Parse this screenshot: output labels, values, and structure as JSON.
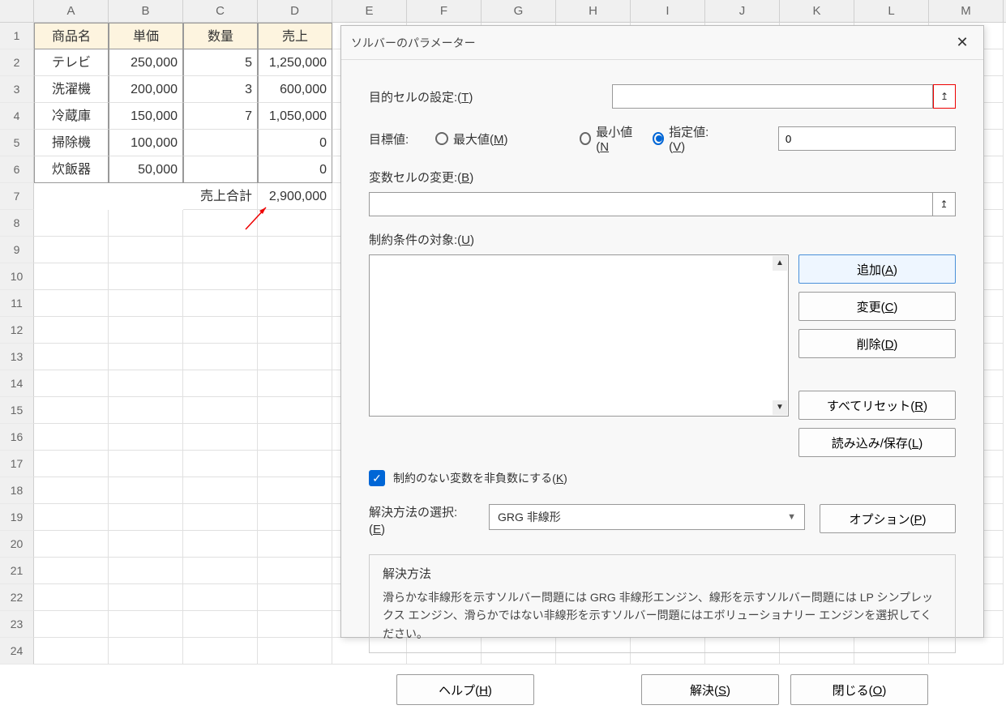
{
  "columns": [
    "A",
    "B",
    "C",
    "D",
    "E",
    "F",
    "G",
    "H",
    "I",
    "J",
    "K",
    "L",
    "M"
  ],
  "rowCount": 24,
  "headers": {
    "a": "商品名",
    "b": "単価",
    "c": "数量",
    "d": "売上"
  },
  "data": [
    {
      "name": "テレビ",
      "price": "250,000",
      "qty": "5",
      "sales": "1,250,000"
    },
    {
      "name": "洗濯機",
      "price": "200,000",
      "qty": "3",
      "sales": "600,000"
    },
    {
      "name": "冷蔵庫",
      "price": "150,000",
      "qty": "7",
      "sales": "1,050,000"
    },
    {
      "name": "掃除機",
      "price": "100,000",
      "qty": "",
      "sales": "0"
    },
    {
      "name": "炊飯器",
      "price": "50,000",
      "qty": "",
      "sales": "0"
    }
  ],
  "totalRow": {
    "label": "売上合計",
    "value": "2,900,000"
  },
  "dialog": {
    "title": "ソルバーのパラメーター",
    "objectiveLabel": "目的セルの設定:(T)",
    "objectiveValue": "",
    "targetLabel": "目標値:",
    "radioMax": "最大値(M)",
    "radioMin": "最小値(N",
    "radioValue": "指定値:(V)",
    "targetValueInput": "0",
    "variableLabel": "変数セルの変更:(B)",
    "variableValue": "",
    "constraintsLabel": "制約条件の対象:(U)",
    "btnAdd": "追加(A)",
    "btnChange": "変更(C)",
    "btnDelete": "削除(D)",
    "btnResetAll": "すべてリセット(R)",
    "btnLoadSave": "読み込み/保存(L)",
    "checkboxLabel": "制約のない変数を非負数にする(K)",
    "methodLabel": "解決方法の選択:(E)",
    "methodValue": "GRG 非線形",
    "btnOptions": "オプション(P)",
    "solutionTitle": "解決方法",
    "solutionText": "滑らかな非線形を示すソルバー問題には GRG 非線形エンジン、線形を示すソルバー問題には LP シンプレックス エンジン、滑らかではない非線形を示すソルバー問題にはエボリューショナリー エンジンを選択してください。",
    "btnHelp": "ヘルプ(H)",
    "btnSolve": "解決(S)",
    "btnClose": "閉じる(O)"
  }
}
